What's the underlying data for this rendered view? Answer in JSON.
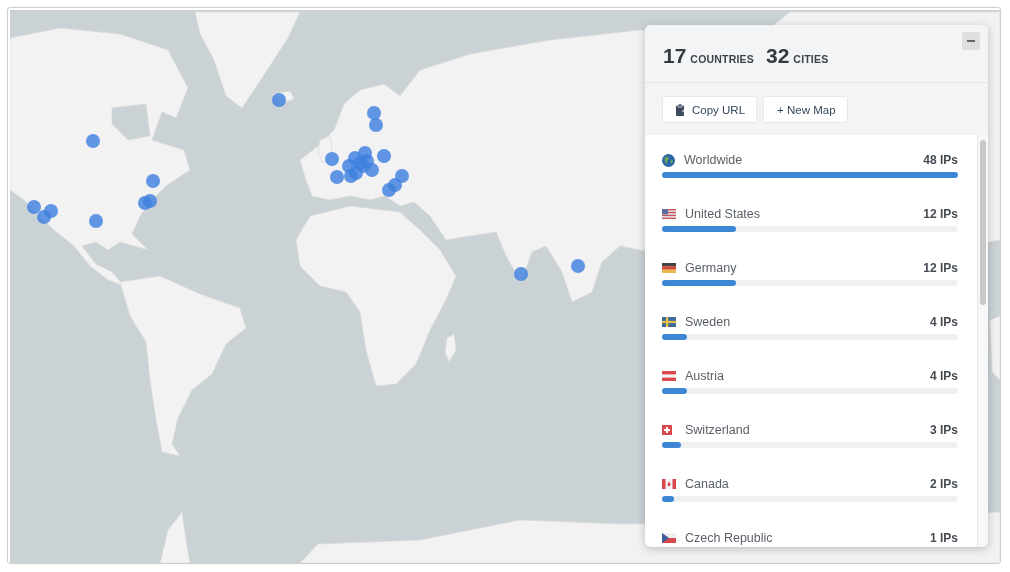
{
  "summary": {
    "countries": {
      "value": "17",
      "label": "COUNTRIES"
    },
    "cities": {
      "value": "32",
      "label": "CITIES"
    }
  },
  "actions": [
    {
      "label": "Copy URL",
      "kind": "copy"
    },
    {
      "label": "+ New Map",
      "kind": "plain"
    }
  ],
  "locations": [
    {
      "name": "Worldwide",
      "count": "48 IPs",
      "level": 1
    },
    {
      "name": "United States",
      "count": "12 IPs",
      "level": 0.25
    },
    {
      "name": "Germany",
      "count": "12 IPs",
      "level": 0.25
    },
    {
      "name": "Sweden",
      "count": "4 IPs",
      "level": 0.083
    },
    {
      "name": "Austria",
      "count": "4 IPs",
      "level": 0.083
    },
    {
      "name": "Switzerland",
      "count": "3 IPs",
      "level": 0.0625
    },
    {
      "name": "Canada",
      "count": "2 IPs",
      "level": 0.042
    },
    {
      "name": "Czech Republic",
      "count": "1 IPs"
    }
  ]
}
